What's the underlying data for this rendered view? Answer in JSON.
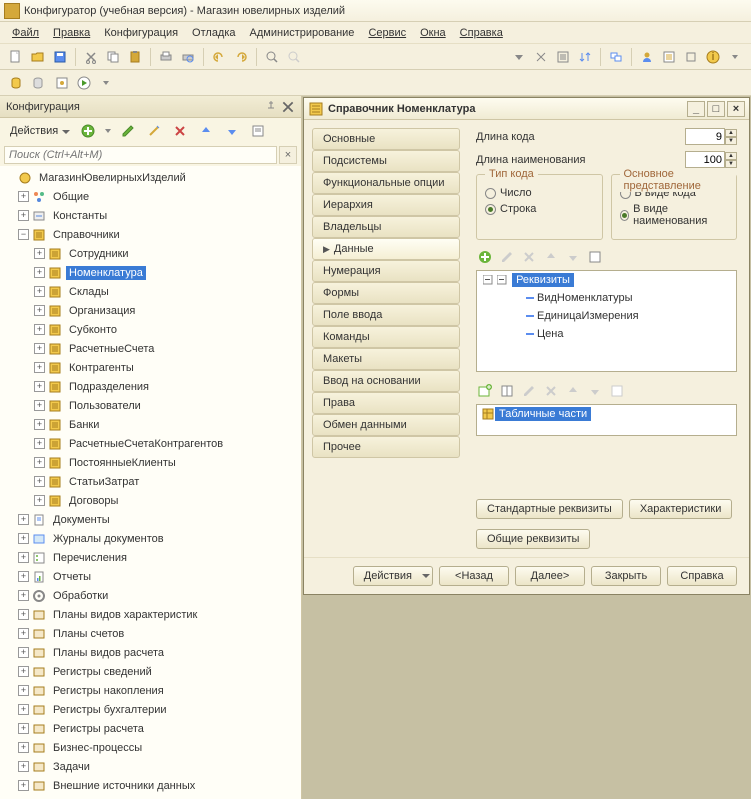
{
  "titlebar": {
    "text": "Конфигуратор (учебная версия) - Магазин ювелирных изделий"
  },
  "menu": {
    "file": "Файл",
    "edit": "Правка",
    "config": "Конфигурация",
    "debug": "Отладка",
    "admin": "Администрирование",
    "service": "Сервис",
    "windows": "Окна",
    "help": "Справка"
  },
  "panel": {
    "title": "Конфигурация",
    "actions": "Действия",
    "search_placeholder": "Поиск (Ctrl+Alt+M)"
  },
  "tree": {
    "root": "МагазинЮвелирныхИзделий",
    "items": [
      {
        "label": "Общие"
      },
      {
        "label": "Константы"
      },
      {
        "label": "Справочники",
        "expanded": true,
        "children": [
          {
            "label": "Сотрудники"
          },
          {
            "label": "Номенклатура",
            "selected": true
          },
          {
            "label": "Склады"
          },
          {
            "label": "Организация"
          },
          {
            "label": "Субконто"
          },
          {
            "label": "РасчетныеСчета"
          },
          {
            "label": "Контрагенты"
          },
          {
            "label": "Подразделения"
          },
          {
            "label": "Пользователи"
          },
          {
            "label": "Банки"
          },
          {
            "label": "РасчетныеСчетаКонтрагентов"
          },
          {
            "label": "ПостоянныеКлиенты"
          },
          {
            "label": "СтатьиЗатрат"
          },
          {
            "label": "Договоры"
          }
        ]
      },
      {
        "label": "Документы"
      },
      {
        "label": "Журналы документов"
      },
      {
        "label": "Перечисления"
      },
      {
        "label": "Отчеты"
      },
      {
        "label": "Обработки"
      },
      {
        "label": "Планы видов характеристик"
      },
      {
        "label": "Планы счетов"
      },
      {
        "label": "Планы видов расчета"
      },
      {
        "label": "Регистры сведений"
      },
      {
        "label": "Регистры накопления"
      },
      {
        "label": "Регистры бухгалтерии"
      },
      {
        "label": "Регистры расчета"
      },
      {
        "label": "Бизнес-процессы"
      },
      {
        "label": "Задачи"
      },
      {
        "label": "Внешние источники данных"
      }
    ]
  },
  "dialog": {
    "title": "Справочник Номенклатура",
    "tabs": [
      "Основные",
      "Подсистемы",
      "Функциональные опции",
      "Иерархия",
      "Владельцы",
      "Данные",
      "Нумерация",
      "Формы",
      "Поле ввода",
      "Команды",
      "Макеты",
      "Ввод на основании",
      "Права",
      "Обмен данными",
      "Прочее"
    ],
    "active_tab": "Данные",
    "code_len_label": "Длина кода",
    "code_len_value": "9",
    "name_len_label": "Длина наименования",
    "name_len_value": "100",
    "type_legend": "Тип кода",
    "type_number": "Число",
    "type_string": "Строка",
    "repr_legend": "Основное представление",
    "repr_code": "В виде кода",
    "repr_name": "В виде наименования",
    "attrs_root": "Реквизиты",
    "attrs": [
      "ВидНоменклатуры",
      "ЕдиницаИзмерения",
      "Цена"
    ],
    "tables_root": "Табличные части",
    "std_attrs": "Стандартные реквизиты",
    "characteristics": "Характеристики",
    "common_attrs": "Общие реквизиты",
    "actions": "Действия",
    "back": "<Назад",
    "next": "Далее>",
    "close": "Закрыть",
    "help": "Справка"
  }
}
